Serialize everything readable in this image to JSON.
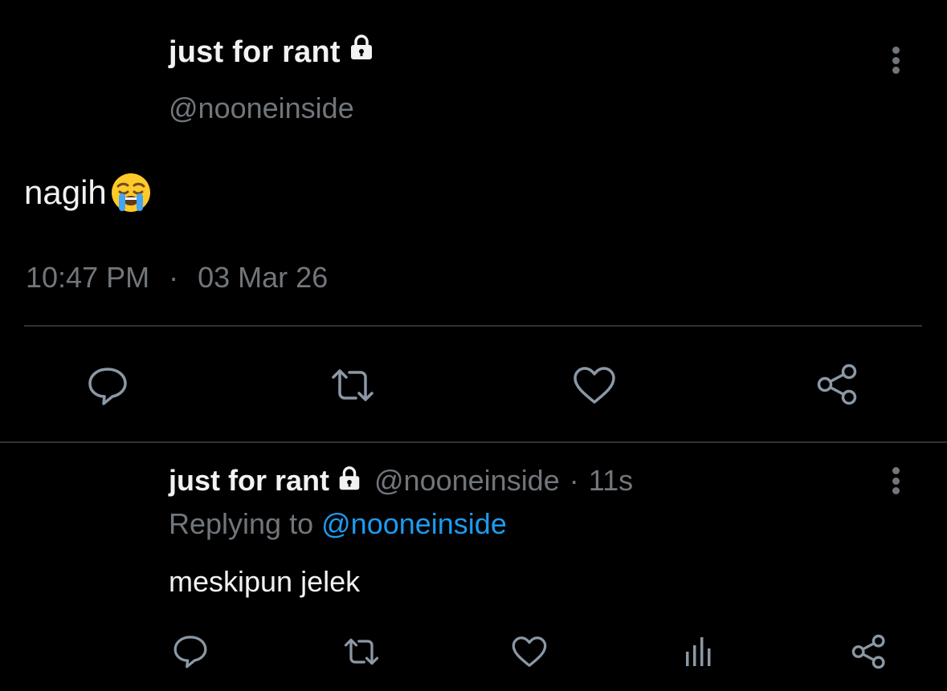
{
  "main_tweet": {
    "display_name": "just for rant",
    "handle": "@nooneinside",
    "text": "nagih",
    "emoji": "loudly-crying-face",
    "time": "10:47 PM",
    "date_separator": "·",
    "date": "03 Mar 26",
    "actions": [
      "reply-icon",
      "retweet-icon",
      "like-icon",
      "share-icon"
    ],
    "more_icon": "more-vertical-icon"
  },
  "reply_tweet": {
    "display_name": "just for rant",
    "handle": "@nooneinside",
    "separator": "·",
    "time": "11s",
    "replying_prefix": "Replying to",
    "replying_handle": "@nooneinside",
    "text": "meskipun jelek",
    "actions": [
      "reply-icon",
      "retweet-icon",
      "like-icon",
      "analytics-icon",
      "share-icon"
    ],
    "more_icon": "more-vertical-icon"
  },
  "colors": {
    "background": "#000000",
    "text_primary": "#f2f2f2",
    "text_secondary": "#71767b",
    "link": "#1d9bf0",
    "divider": "#2f3336",
    "icon": "#71767b"
  }
}
